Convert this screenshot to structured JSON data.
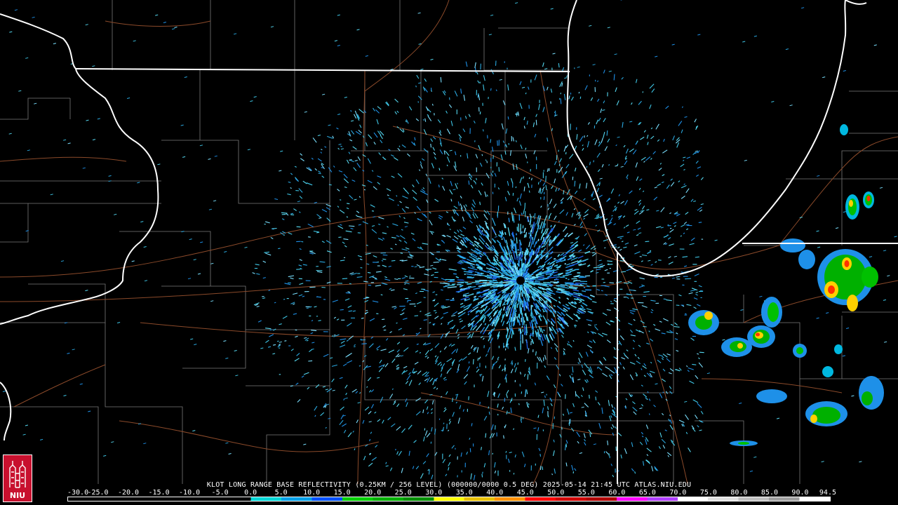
{
  "caption": "KLOT LONG RANGE BASE REFLECTIVITY (0.25KM / 256 LEVEL) (000000/0000 0.5 DEG) 2025-05-14 21:45 UTC  ATLAS.NIU.EDU",
  "logo": {
    "text": "NIU",
    "color": "#c8102e"
  },
  "scale": {
    "labels": [
      "-30.0",
      "-25.0",
      "-20.0",
      "-15.0",
      "-10.0",
      "-5.0",
      "0.0",
      "5.0",
      "10.0",
      "15.0",
      "20.0",
      "25.0",
      "30.0",
      "35.0",
      "40.0",
      "45.0",
      "50.0",
      "55.0",
      "60.0",
      "65.0",
      "70.0",
      "75.0",
      "80.0",
      "85.0",
      "90.0",
      "94.5"
    ],
    "colors": [
      "#000000",
      "#000000",
      "#000000",
      "#000000",
      "#000000",
      "#000000",
      "#00d6d6",
      "#00a0e8",
      "#0050ff",
      "#00d000",
      "#00b000",
      "#009000",
      "#ffff00",
      "#e8c000",
      "#ff9000",
      "#ff0000",
      "#d00000",
      "#b00000",
      "#ff00ff",
      "#b040ff",
      "#ffffff",
      "#e0e0e0",
      "#c0c0c0",
      "#a0a0a0",
      "#ffffff"
    ]
  },
  "radar": {
    "site_color": "#000000",
    "noise_colors": [
      "#3fc8e8",
      "#2aa8e0",
      "#55d8f0",
      "#1e90e8",
      "#7ae0ff"
    ]
  }
}
